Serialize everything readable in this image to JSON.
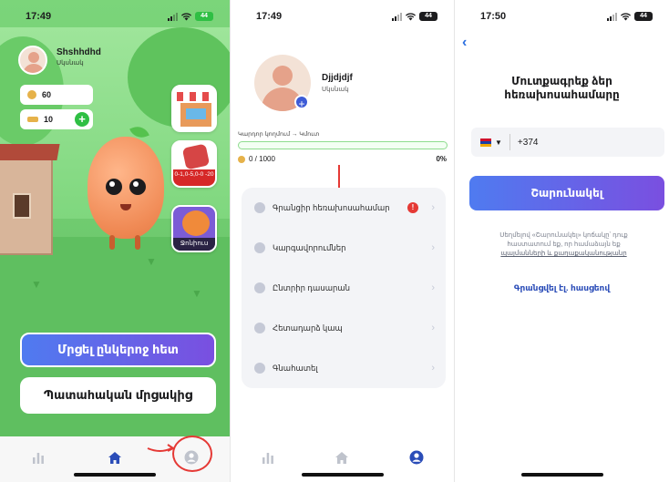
{
  "screen1": {
    "time": "17:49",
    "battery": "44",
    "user_name": "Shshhdhd",
    "user_role": "Սկսնակ",
    "coins": "60",
    "keys": "10",
    "plus_glyph": "+",
    "vote_card_text": "0-1,0-5,0-0 -20",
    "club_card_label": "Ջոնիուս",
    "primary_button": "Մրցել ընկերոջ հետ",
    "secondary_button": "Պատահական մրցակից"
  },
  "screen2": {
    "time": "17:49",
    "battery": "44",
    "user_name": "Djjdjdjf",
    "user_role": "Սկսնակ",
    "plus_glyph": "+",
    "level_text": "Կարդոր կողմում → Կմուտ",
    "progress_value": 0,
    "points": "0 / 1000",
    "percent": "0%",
    "menu": [
      {
        "label": "Գրանցիր հեռախոսահամար",
        "alert": "!"
      },
      {
        "label": "Կարգավորումներ"
      },
      {
        "label": "Ընտրիր դասարան"
      },
      {
        "label": "Հետադարձ կապ"
      },
      {
        "label": "Գնահատել"
      }
    ],
    "chevron": "›"
  },
  "screen3": {
    "time": "17:50",
    "battery": "44",
    "back_glyph": "‹",
    "title_line1": "Մուտքագրեք ձեր",
    "title_line2": "հեռախոսահամարը",
    "country_code": "+374",
    "caret": "▼",
    "cta": "Շարունակել",
    "terms_line1": "Սեղմելով «Շարունակել» կոճակը՝ դուք",
    "terms_line2": "հաստատում եք, որ համաձայն եք",
    "terms_link": "պայմանների և քաղաքականությանը",
    "login_link": "Գրանցվել էլ. հասցեով"
  },
  "icons": {
    "tab_stats": "stats-icon",
    "tab_home": "home-icon",
    "tab_profile": "profile-icon"
  },
  "colors": {
    "accent_gradient_start": "#4f7bf0",
    "accent_gradient_end": "#7a4fe0",
    "active_tab": "#2b4db8",
    "annotation_red": "#e53935",
    "game_green": "#5fbf60"
  }
}
